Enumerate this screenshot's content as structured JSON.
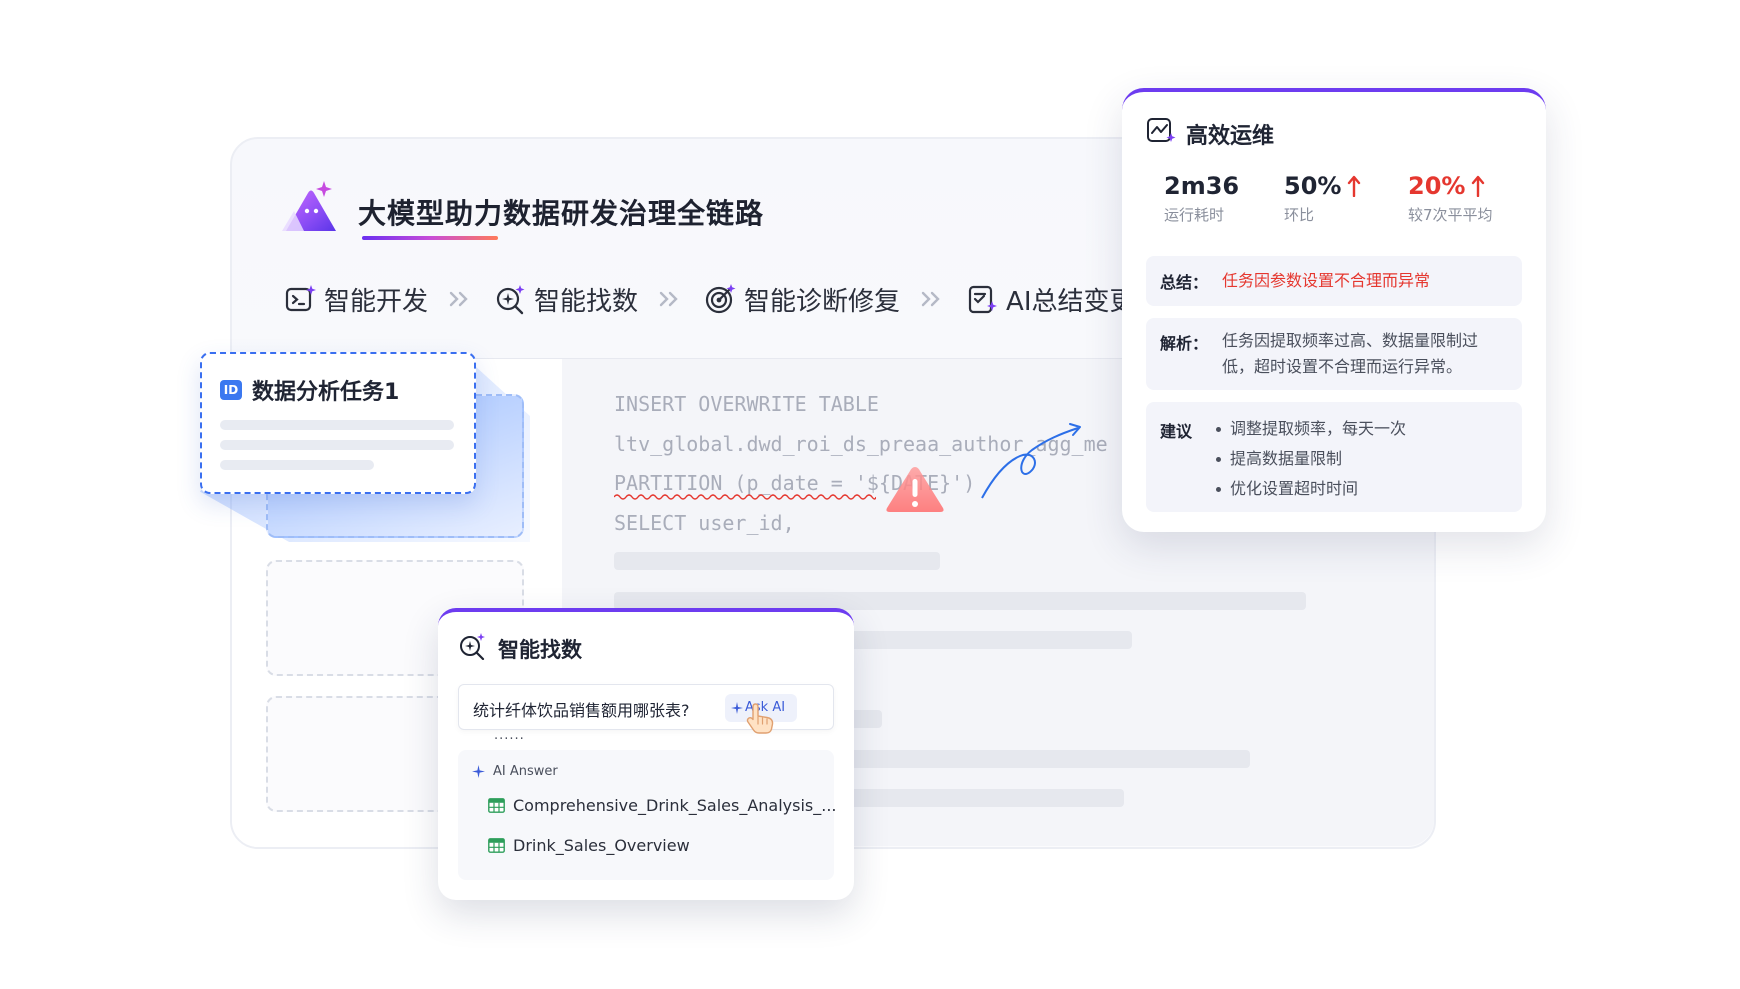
{
  "header": {
    "title": "大模型助力数据研发治理全链路"
  },
  "pipeline": [
    {
      "label": "智能开发",
      "icon": "terminal-spark-icon"
    },
    {
      "label": "智能找数",
      "icon": "search-spark-icon"
    },
    {
      "label": "智能诊断修复",
      "icon": "target-spark-icon"
    },
    {
      "label": "AI总结变更",
      "icon": "document-spark-icon"
    }
  ],
  "task_card": {
    "badge": "ID",
    "title": "数据分析任务1"
  },
  "code_lines": [
    "INSERT OVERWRITE TABLE",
    "ltv_global.dwd_roi_ds_preaa_author_agg_me",
    "PARTITION (p_date = '${DATE}')",
    "SELECT  user_id,"
  ],
  "ops_card": {
    "title": "高效运维",
    "metrics": [
      {
        "value": "2m36",
        "label": "运行耗时",
        "trend": ""
      },
      {
        "value": "50%",
        "label": "环比",
        "trend": "up"
      },
      {
        "value": "20%",
        "label": "较7次平平均",
        "trend": "up"
      }
    ],
    "summary_label": "总结：",
    "summary_text": "任务因参数设置不合理而异常",
    "analysis_label": "解析：",
    "analysis_line1": "任务因提取频率过高、数据量限制过",
    "analysis_line2": "低，超时设置不合理而运行异常。",
    "advice_label": "建议",
    "advice": [
      "调整提取频率，每天一次",
      "提高数据量限制",
      "优化设置超时时间"
    ],
    "colors": {
      "accent": "#6d3cf0",
      "alert": "#e5372f"
    }
  },
  "find_card": {
    "title": "智能找数",
    "query": "统计纤体饮品销售额用哪张表?",
    "ask_label": "Ask AI",
    "answer_header": "AI Answer",
    "results": [
      "Comprehensive_Drink_Sales_Analysis_...",
      "Drink_Sales_Overview"
    ],
    "more": "......"
  }
}
